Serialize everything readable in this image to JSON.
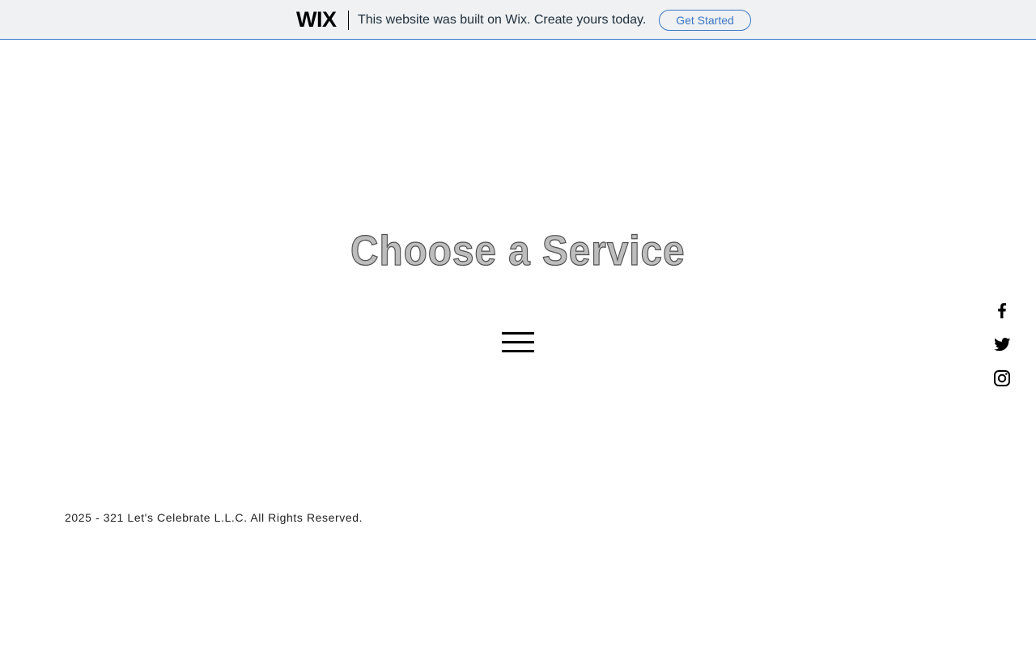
{
  "wix_banner": {
    "logo": "WIX",
    "message": "This website was built on Wix. Create yours today.",
    "cta_label": "Get Started",
    "accent_color": "#3c78c6",
    "background_color": "#eff1f3"
  },
  "hero": {
    "title": "Choose a Service"
  },
  "menu": {
    "icon": "hamburger-menu-icon"
  },
  "social": {
    "items": [
      {
        "icon": "facebook-icon"
      },
      {
        "icon": "twitter-icon"
      },
      {
        "icon": "instagram-icon"
      }
    ]
  },
  "footer": {
    "copyright": "2025 - 321 Let's Celebrate L.L.C. All Rights Reserved."
  }
}
